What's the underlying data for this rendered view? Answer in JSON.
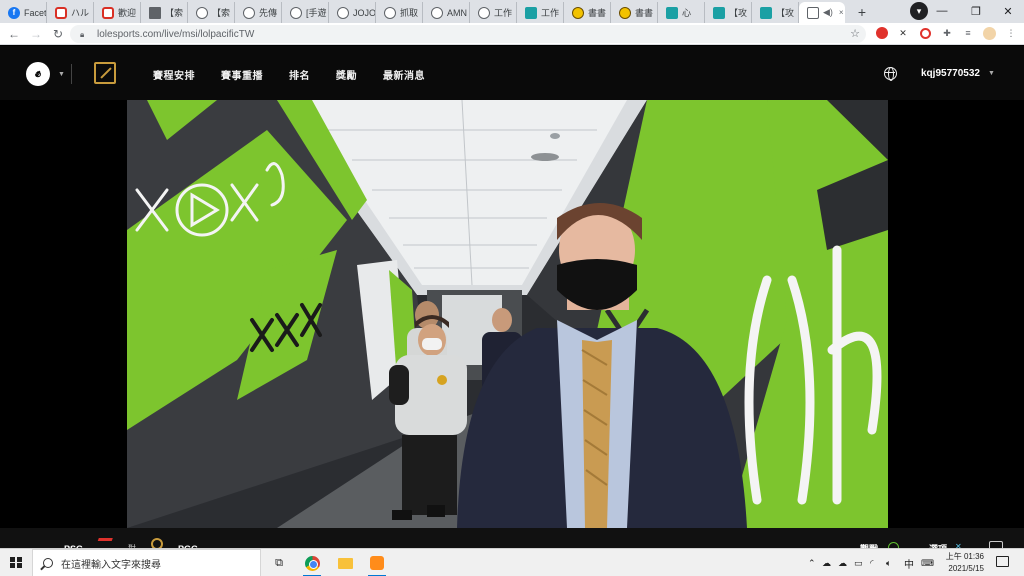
{
  "browser": {
    "tabs": [
      {
        "label": "Facet",
        "icon": "facebook-icon"
      },
      {
        "label": "ハル",
        "icon": "red-square-icon"
      },
      {
        "label": "歡迎",
        "icon": "red-square-icon"
      },
      {
        "label": "【索",
        "icon": "house-icon"
      },
      {
        "label": "【索",
        "icon": "globe-icon"
      },
      {
        "label": "先傳",
        "icon": "globe-icon"
      },
      {
        "label": "[手遊",
        "icon": "globe-icon"
      },
      {
        "label": "JOJO",
        "icon": "globe-icon"
      },
      {
        "label": "抓取",
        "icon": "globe-icon"
      },
      {
        "label": "AMN",
        "icon": "globe-icon"
      },
      {
        "label": "工作",
        "icon": "globe-icon"
      },
      {
        "label": "工作",
        "icon": "teal-icon"
      },
      {
        "label": "書書",
        "icon": "gold-icon"
      },
      {
        "label": "書書",
        "icon": "gold-icon"
      },
      {
        "label": "心",
        "icon": "teal-icon"
      },
      {
        "label": "【攻",
        "icon": "teal-icon"
      },
      {
        "label": "【攻",
        "icon": "teal-icon"
      }
    ],
    "active_tab_close": "×",
    "new_tab": "+",
    "url": "lolesports.com/live/msi/lolpacificTW",
    "window_controls": {
      "minimize": "—",
      "maximize": "❐",
      "close": "✕"
    }
  },
  "site": {
    "nav": [
      "賽程安排",
      "賽事重播",
      "排名",
      "獎勵",
      "最新消息"
    ],
    "username": "kqj95770532"
  },
  "bottom_bar": {
    "team_left": "PSG",
    "vs": "對",
    "team_right": "PGG",
    "right_label_1": "觀戰",
    "right_label_2": "選項"
  },
  "taskbar": {
    "search_placeholder": "在這裡輸入文字來搜尋",
    "time": "上午 01:36",
    "date": "2021/5/15",
    "ime": "中"
  },
  "colors": {
    "accent_gold": "#c89b3c",
    "green_panel": "#7dc52e",
    "header_bg": "#0a0a0a"
  }
}
